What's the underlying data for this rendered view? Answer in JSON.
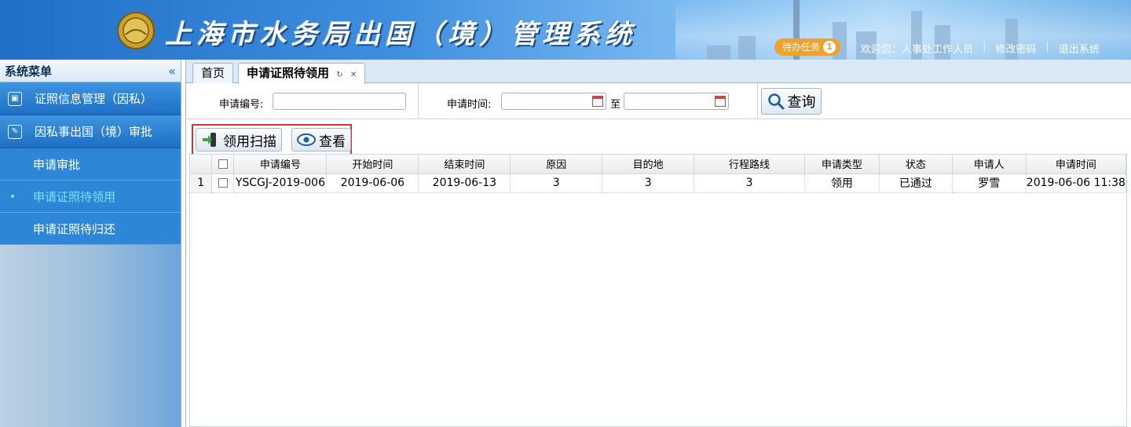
{
  "header": {
    "system_title": "上海市水务局出国（境）管理系统",
    "todo_label": "待办任务",
    "todo_count": "1",
    "welcome": "欢迎您：人事处工作人员",
    "change_password": "修改密码",
    "logout": "退出系统",
    "separator": "|"
  },
  "sidebar": {
    "title": "系统菜单",
    "collapse_icon": "double-chevron-left-icon",
    "groups": [
      {
        "label": "证照信息管理（因私）",
        "icon": "image-icon"
      },
      {
        "label": "因私事出国（境）审批",
        "icon": "edit-icon"
      }
    ],
    "items": [
      {
        "label": "申请审批",
        "active": false
      },
      {
        "label": "申请证照待领用",
        "active": true
      },
      {
        "label": "申请证照待归还",
        "active": false
      }
    ],
    "active_color": "#7ee3ff"
  },
  "tabs": [
    {
      "label": "首页",
      "active": false
    },
    {
      "label": "申请证照待领用",
      "active": true,
      "refresh_icon": "refresh-icon",
      "close_icon": "close-icon"
    }
  ],
  "search": {
    "app_no_label": "申请编号:",
    "app_no_value": "",
    "time_label": "申请时间:",
    "time_from": "",
    "to_label": "至",
    "time_to": "",
    "query_label": "查询"
  },
  "toolbar": {
    "scan_label": "领用扫描",
    "view_label": "查看",
    "highlight_color": "#e0312f"
  },
  "grid": {
    "columns": [
      "申请编号",
      "开始时间",
      "结束时间",
      "原因",
      "目的地",
      "行程路线",
      "申请类型",
      "状态",
      "申请人",
      "申请时间"
    ],
    "rows": [
      {
        "no": "1",
        "cells": [
          "YSCGJ-2019-006",
          "2019-06-06",
          "2019-06-13",
          "3",
          "3",
          "3",
          "领用",
          "已通过",
          "罗雪",
          "2019-06-06 11:38"
        ]
      }
    ]
  }
}
